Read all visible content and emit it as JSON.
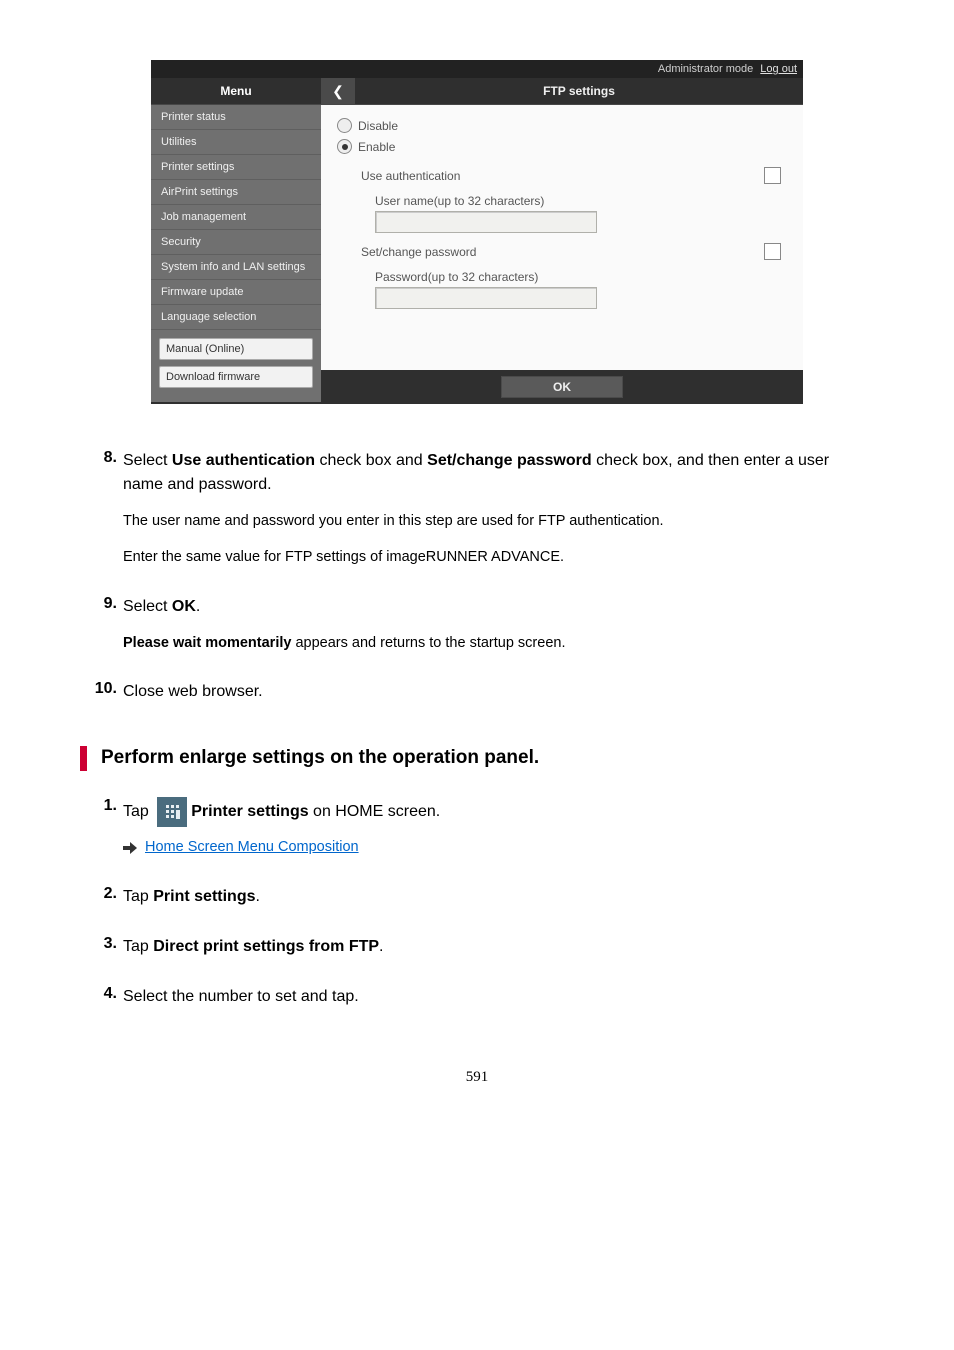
{
  "remote_ui": {
    "mode_label": "Administrator mode",
    "logout_label": "Log out",
    "menu_header": "Menu",
    "sidebar": [
      "Printer status",
      "Utilities",
      "Printer settings",
      "AirPrint settings",
      "Job management",
      "Security",
      "System info and LAN settings",
      "Firmware update",
      "Language selection"
    ],
    "side_buttons": {
      "manual": "Manual (Online)",
      "download": "Download firmware"
    },
    "panel": {
      "title": "FTP settings",
      "disable": "Disable",
      "enable": "Enable",
      "use_auth": "Use authentication",
      "user_name_lbl": "User name(up to 32 characters)",
      "set_change_pw": "Set/change password",
      "password_lbl": "Password(up to 32 characters)",
      "ok": "OK"
    }
  },
  "step8": {
    "num": "8.",
    "prefix": "Select ",
    "b1": "Use authentication",
    "mid1": " check box and ",
    "b2": "Set/change password",
    "suffix": " check box, and then enter a user name and password.",
    "p1": "The user name and password you enter in this step are used for FTP authentication.",
    "p2": "Enter the same value for FTP settings of imageRUNNER ADVANCE."
  },
  "step9": {
    "num": "9.",
    "prefix": "Select ",
    "b1": "OK",
    "suffix": ".",
    "p1_b": "Please wait momentarily",
    "p1_suffix": " appears and returns to the startup screen."
  },
  "step10": {
    "num": "10.",
    "text": "Close web browser."
  },
  "section2_heading": "Perform enlarge settings on the operation panel.",
  "s2_step1": {
    "num": "1.",
    "pre": "Tap ",
    "b": "Printer settings",
    "post": " on HOME screen.",
    "link": "Home Screen Menu Composition"
  },
  "s2_step2": {
    "num": "2.",
    "pre": "Tap ",
    "b": "Print settings",
    "post": "."
  },
  "s2_step3": {
    "num": "3.",
    "pre": "Tap ",
    "b": "Direct print settings from FTP",
    "post": "."
  },
  "s2_step4": {
    "num": "4.",
    "text": "Select the number to set and tap."
  },
  "page_number": "591"
}
